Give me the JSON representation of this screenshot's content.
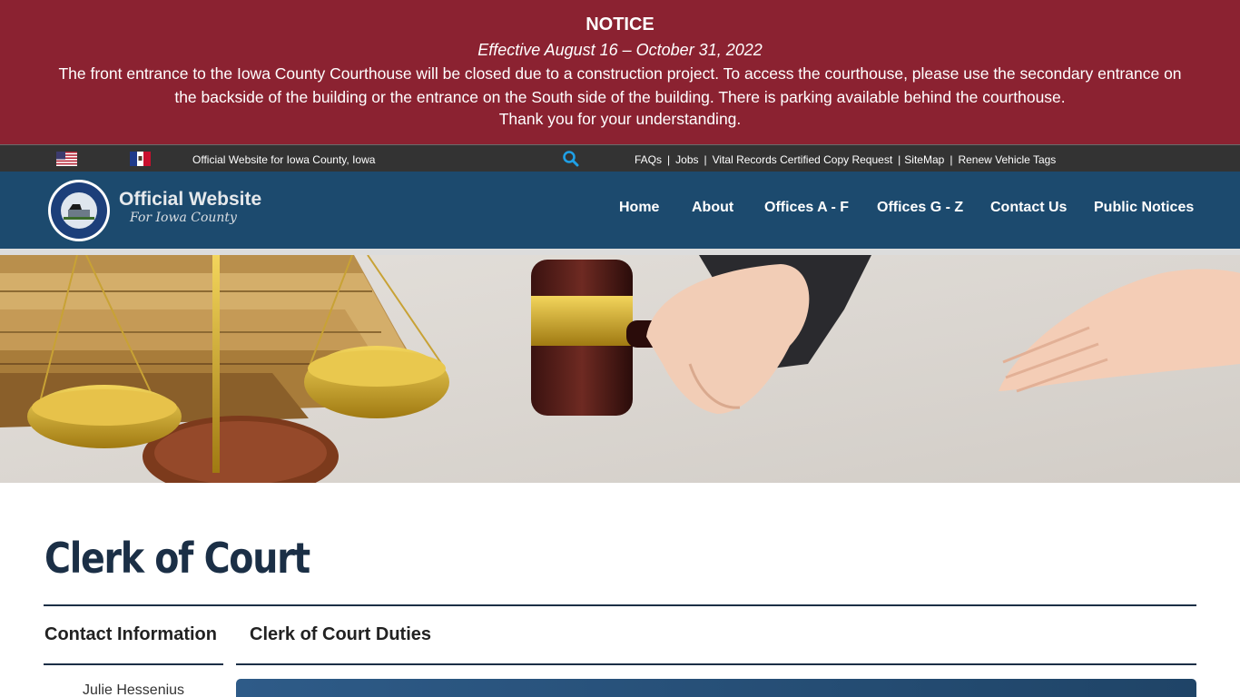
{
  "notice": {
    "title": "NOTICE",
    "dates": "Effective August 16 – October 31, 2022",
    "body": "The front entrance to the Iowa County Courthouse will be closed due to a construction project. To access the courthouse, please use the secondary entrance on the backside of the building or the entrance on the South side of the building. There is parking available behind the courthouse.",
    "thanks": "Thank you for your understanding.",
    "background_color": "#8b2231"
  },
  "utility_bar": {
    "flags": [
      "us-flag-icon",
      "iowa-flag-icon"
    ],
    "tagline": "Official Website for Iowa County, Iowa",
    "search_icon": "search-icon",
    "links": [
      "FAQs",
      "Jobs",
      "Vital Records Certified Copy Request",
      "SiteMap",
      "Renew Vehicle Tags"
    ],
    "separator": "|"
  },
  "header": {
    "seal_text_top": "SEAL OF THE COUNTY OF IOWA",
    "seal_text_bottom": "IOWA",
    "brand_line1": "Official Website",
    "brand_line2": "For Iowa County",
    "nav": [
      "Home",
      "About",
      "Offices A - F",
      "Offices G - Z",
      "Contact Us",
      "Public Notices"
    ],
    "background_color": "#1c4a6e"
  },
  "hero": {
    "description_icon": "courtroom-gavel-scales-image"
  },
  "content": {
    "page_title": "Clerk of Court",
    "sidebar_heading": "Contact Information",
    "contact_name": "Julie Hessenius",
    "main_heading": "Clerk of Court Duties"
  }
}
